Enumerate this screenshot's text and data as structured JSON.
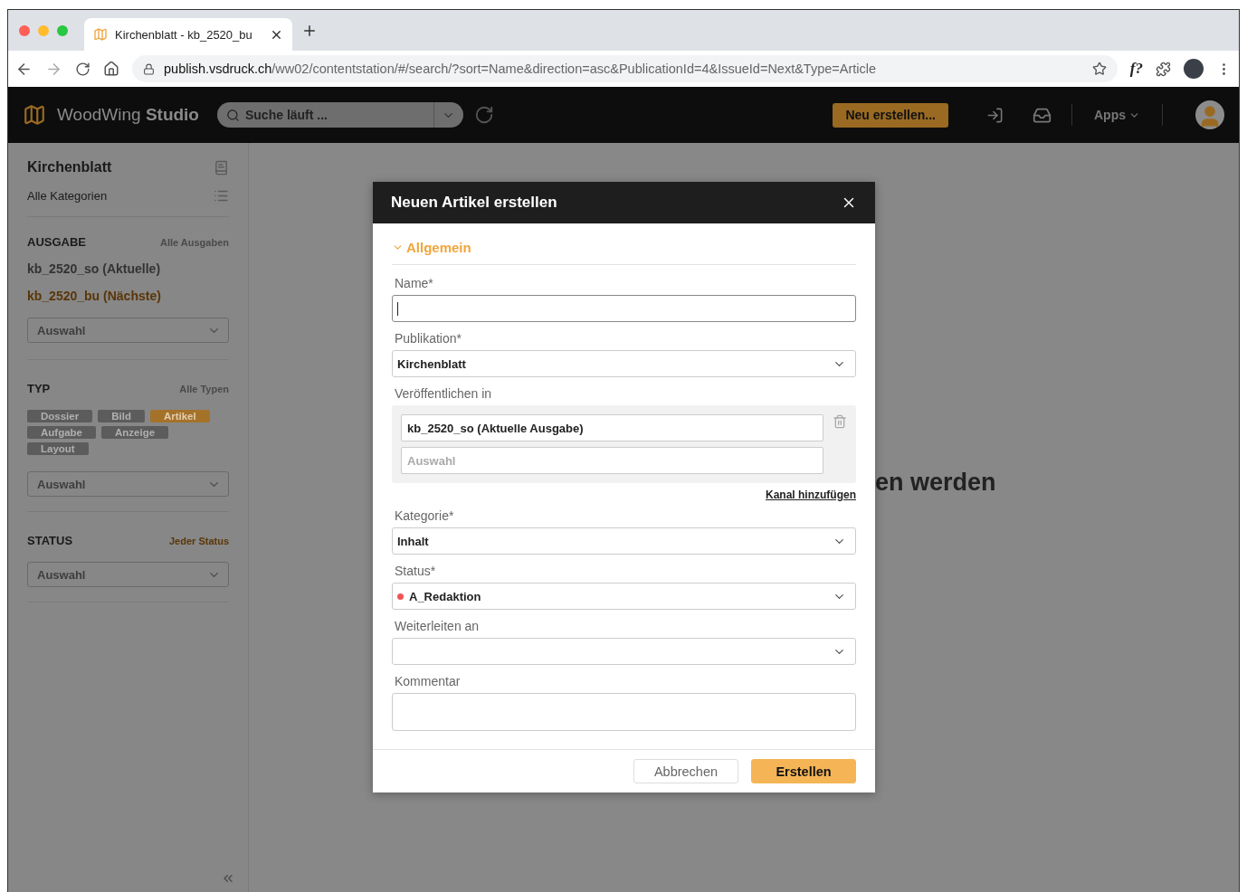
{
  "browser": {
    "tab_title": "Kirchenblatt - kb_2520_bu",
    "url_host": "publish.vsdruck.ch",
    "url_path": "/ww02/contentstation/#/search/?sort=Name&direction=asc&PublicationId=4&IssueId=Next&Type=Article",
    "extension_label": "f?"
  },
  "app_header": {
    "brand": "WoodWing",
    "brand_bold": "Studio",
    "search_value": "Suche läuft ...",
    "new_button": "Neu erstellen...",
    "apps_menu": "Apps"
  },
  "sidebar": {
    "publication": "Kirchenblatt",
    "category": "Alle Kategorien",
    "issue": {
      "title": "AUSGABE",
      "link": "Alle Ausgaben",
      "link_active": false,
      "items": [
        {
          "label": "kb_2520_so (Aktuelle)",
          "selected": false
        },
        {
          "label": "kb_2520_bu (Nächste)",
          "selected": true
        }
      ],
      "dropdown_placeholder": "Auswahl"
    },
    "type": {
      "title": "TYP",
      "link": "Alle Typen",
      "link_active": false,
      "chips": [
        {
          "label": "Dossier",
          "selected": false
        },
        {
          "label": "Bild",
          "selected": false
        },
        {
          "label": "Artikel",
          "selected": true
        },
        {
          "label": "Aufgabe",
          "selected": false
        },
        {
          "label": "Anzeige",
          "selected": false
        },
        {
          "label": "Layout",
          "selected": false
        }
      ],
      "dropdown_placeholder": "Auswahl"
    },
    "status": {
      "title": "STATUS",
      "link": "Jeder Status",
      "link_active": true,
      "dropdown_placeholder": "Auswahl"
    }
  },
  "background_text": "en werden",
  "dialog": {
    "title": "Neuen Artikel erstellen",
    "section": {
      "label": "Allgemein",
      "expanded": true
    },
    "fields": [
      {
        "kind": "text",
        "label": "Name*"
      },
      {
        "kind": "select",
        "label": "Publikation*",
        "value": "Kirchenblatt"
      },
      {
        "kind": "channels",
        "label": "Veröffentlichen in",
        "channels": [
          {
            "value": "kb_2520_so (Aktuelle Ausgabe)"
          }
        ],
        "placeholder": "Auswahl",
        "add_link": "Kanal hinzufügen"
      },
      {
        "kind": "select",
        "label": "Kategorie*",
        "value": "Inhalt"
      },
      {
        "kind": "select",
        "label": "Status*",
        "value": "A_Redaktion",
        "color": "#f05454"
      },
      {
        "kind": "select",
        "label": "Weiterleiten an"
      },
      {
        "kind": "textarea",
        "label": "Kommentar"
      }
    ],
    "cancel_button": "Abbrechen",
    "submit_button": "Erstellen"
  }
}
